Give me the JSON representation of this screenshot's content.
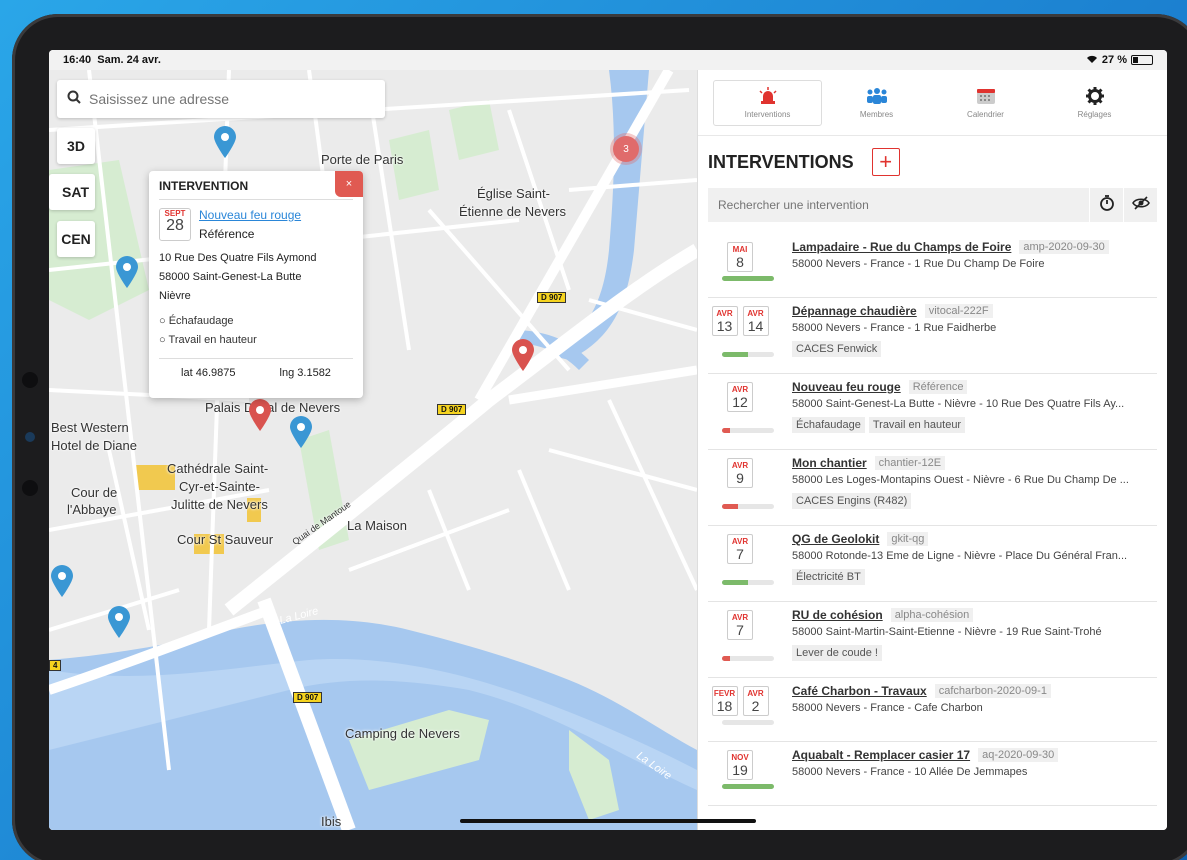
{
  "status_bar": {
    "time": "16:40",
    "date": "Sam. 24 avr.",
    "battery": "27 %"
  },
  "map": {
    "search_placeholder": "Saisissez une adresse",
    "buttons": {
      "btn3d": "3D",
      "sat": "SAT",
      "cen": "CEN"
    },
    "cluster_count": "3",
    "labels": {
      "porte_paris": "Porte de Paris",
      "eglise1": "Église Saint-",
      "eglise2": "Étienne de Nevers",
      "palais": "Palais Ducal de Nevers",
      "best_western1": "Best Western",
      "best_western2": "Hotel de Diane",
      "cathedrale1": "Cathédrale Saint-",
      "cathedrale2": "Cyr-et-Sainte-",
      "cathedrale3": "Julitte de Nevers",
      "cour_abbaye1": "Cour de",
      "cour_abbaye2": "l'Abbaye",
      "cour_st_sauveur": "Cour St Sauveur",
      "quai": "Quai de Mantoue",
      "la_maison": "La Maison",
      "camping": "Camping de Nevers",
      "ibis": "Ibis",
      "la_loire1": "La Loire",
      "la_loire2": "La Loire"
    },
    "road_badges": {
      "d907a": "D 907",
      "d907b": "D 907",
      "d907c": "D 907",
      "n4": "4"
    },
    "popup": {
      "header": "INTERVENTION",
      "close": "×",
      "month": "SEPT",
      "day": "28",
      "title": "Nouveau feu rouge",
      "reference": "Référence",
      "address1": "10 Rue Des Quatre Fils Aymond",
      "address2": "58000 Saint-Genest-La Butte",
      "address3": "Nièvre",
      "tag1": "Échafaudage",
      "tag2": "Travail en hauteur",
      "lat": "lat 46.9875",
      "lng": "lng 3.1582"
    }
  },
  "panel": {
    "tabs": [
      {
        "label": "Interventions",
        "icon": "siren-icon"
      },
      {
        "label": "Membres",
        "icon": "people-icon"
      },
      {
        "label": "Calendrier",
        "icon": "calendar-icon"
      },
      {
        "label": "Réglages",
        "icon": "gear-icon"
      }
    ],
    "title": "INTERVENTIONS",
    "add_label": "+",
    "search_placeholder": "Rechercher une intervention",
    "items": [
      {
        "m1": "MAI",
        "d1": "8",
        "title": "Lampadaire - Rue du Champs de Foire",
        "ref": "amp-2020-09-30",
        "addr": "58000 Nevers - France - 1 Rue Du Champ De Foire",
        "progress": 100,
        "color": "#7cba6a",
        "tags": []
      },
      {
        "m1": "AVR",
        "d1": "13",
        "m2": "AVR",
        "d2": "14",
        "title": "Dépannage chaudière",
        "ref": "vitocal-222F",
        "addr": "58000 Nevers - France - 1 Rue Faidherbe",
        "progress": 50,
        "color": "#7cba6a",
        "tags": [
          "CACES Fenwick"
        ]
      },
      {
        "m1": "AVR",
        "d1": "12",
        "title": "Nouveau feu rouge",
        "ref": "Référence",
        "addr": "58000 Saint-Genest-La Butte - Nièvre - 10 Rue Des Quatre Fils Ay...",
        "progress": 15,
        "color": "#e05a52",
        "tags": [
          "Échafaudage",
          "Travail en hauteur"
        ]
      },
      {
        "m1": "AVR",
        "d1": "9",
        "title": "Mon chantier",
        "ref": "chantier-12E",
        "addr": "58000 Les Loges-Montapins Ouest - Nièvre - 6 Rue Du Champ De ...",
        "progress": 30,
        "color": "#e05a52",
        "tags": [
          "CACES Engins (R482)"
        ]
      },
      {
        "m1": "AVR",
        "d1": "7",
        "title": "QG de Geolokit",
        "ref": "gkit-qg",
        "addr": "58000 Rotonde-13 Eme de Ligne - Nièvre - Place Du Général Fran...",
        "progress": 50,
        "color": "#7cba6a",
        "tags": [
          "Électricité BT"
        ]
      },
      {
        "m1": "AVR",
        "d1": "7",
        "title": "RU de cohésion",
        "ref": "alpha-cohésion",
        "addr": "58000 Saint-Martin-Saint-Etienne - Nièvre - 19 Rue Saint-Trohé",
        "progress": 15,
        "color": "#e05a52",
        "tags": [
          "Lever de coude !"
        ]
      },
      {
        "m1": "FEVR",
        "d1": "18",
        "m2": "AVR",
        "d2": "2",
        "title": "Café Charbon - Travaux",
        "ref": "cafcharbon-2020-09-1",
        "addr": "58000 Nevers - France - Cafe Charbon",
        "progress": 0,
        "color": "#7cba6a",
        "tags": []
      },
      {
        "m1": "NOV",
        "d1": "19",
        "title": "Aquabalt - Remplacer casier 17",
        "ref": "aq-2020-09-30",
        "addr": "58000 Nevers - France - 10 Allée De Jemmapes",
        "progress": 100,
        "color": "#7cba6a",
        "tags": []
      }
    ]
  },
  "colors": {
    "accent_red": "#e0332f",
    "pin_blue": "#3a97d4",
    "pin_red": "#d9534f",
    "river": "#a6c8ef"
  }
}
